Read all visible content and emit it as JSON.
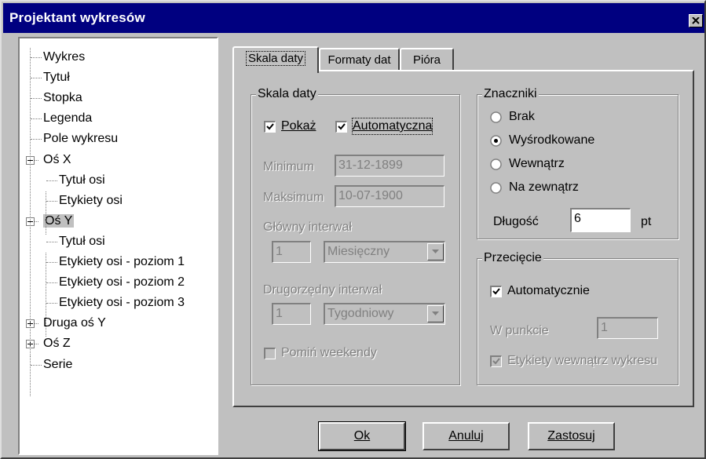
{
  "window": {
    "title": "Projektant wykresów"
  },
  "tree": {
    "items": [
      {
        "label": "Wykres"
      },
      {
        "label": "Tytuł"
      },
      {
        "label": "Stopka"
      },
      {
        "label": "Legenda"
      },
      {
        "label": "Pole wykresu"
      },
      {
        "label": "Oś X",
        "expander": "minus"
      },
      {
        "label": "Tytuł osi"
      },
      {
        "label": "Etykiety osi"
      },
      {
        "label": "Oś Y",
        "expander": "minus",
        "selected": true
      },
      {
        "label": "Tytuł osi"
      },
      {
        "label": "Etykiety osi - poziom 1"
      },
      {
        "label": "Etykiety osi - poziom 2"
      },
      {
        "label": "Etykiety osi - poziom 3"
      },
      {
        "label": "Druga oś Y",
        "expander": "plus"
      },
      {
        "label": "Oś Z",
        "expander": "plus"
      },
      {
        "label": "Serie"
      }
    ]
  },
  "tabs": [
    {
      "label": "Skala daty",
      "active": true
    },
    {
      "label": "Formaty dat"
    },
    {
      "label": "Pióra"
    }
  ],
  "date_scale": {
    "group_title": "Skala daty",
    "show_label": "Pokaż",
    "show_checked": true,
    "auto_label": "Automatyczna",
    "auto_checked": true,
    "min_label": "Minimum",
    "min_value": "31-12-1899",
    "max_label": "Maksimum",
    "max_value": "10-07-1900",
    "major_label": "Główny interwał",
    "major_value": "1",
    "major_unit": "Miesięczny",
    "minor_label": "Drugorzędny interwał",
    "minor_value": "1",
    "minor_unit": "Tygodniowy",
    "skip_weekends_label": "Pomiń weekendy",
    "skip_weekends_checked": false
  },
  "ticks": {
    "group_title": "Znaczniki",
    "options": [
      {
        "label": "Brak",
        "selected": false
      },
      {
        "label": "Wyśrodkowane",
        "selected": true
      },
      {
        "label": "Wewnątrz",
        "selected": false
      },
      {
        "label": "Na zewnątrz",
        "selected": false
      }
    ],
    "length_label": "Długość",
    "length_value": "6",
    "length_unit": "pt"
  },
  "crossing": {
    "group_title": "Przecięcie",
    "auto_label": "Automatycznie",
    "auto_checked": true,
    "at_point_label": "W punkcie",
    "at_point_value": "1",
    "labels_inside_label": "Etykiety wewnątrz wykresu",
    "labels_inside_checked": true
  },
  "buttons": {
    "ok": "Ok",
    "cancel": "Anuluj",
    "apply": "Zastosuj"
  }
}
